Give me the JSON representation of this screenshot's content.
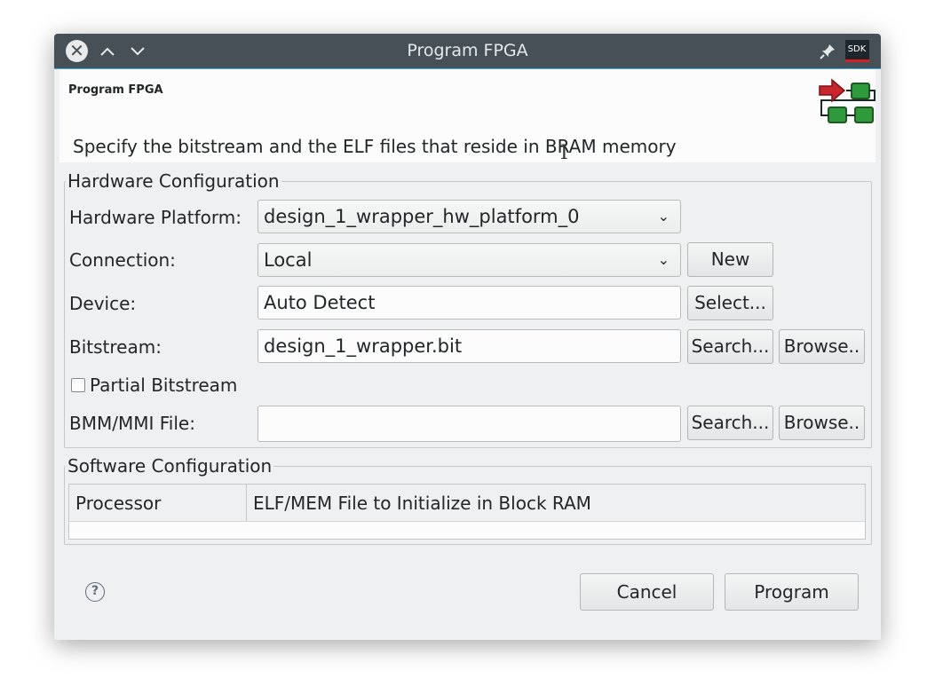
{
  "window": {
    "title": "Program FPGA",
    "sdk_badge": "SDK",
    "accent_color": "#3daee9",
    "titlebar_color": "#475057"
  },
  "header": {
    "title": "Program FPGA",
    "description": "Specify the bitstream and the ELF files that reside in BRAM memory"
  },
  "hardware": {
    "group_title": "Hardware Configuration",
    "platform_label": "Hardware Platform:",
    "platform_value": "design_1_wrapper_hw_platform_0",
    "connection_label": "Connection:",
    "connection_value": "Local",
    "new_button": "New",
    "device_label": "Device:",
    "device_value": "Auto Detect",
    "select_button": "Select...",
    "bitstream_label": "Bitstream:",
    "bitstream_value": "design_1_wrapper.bit",
    "search_button": "Search...",
    "browse_button": "Browse..",
    "partial_label": "Partial Bitstream",
    "partial_checked": false,
    "bmm_label": "BMM/MMI File:",
    "bmm_value": "",
    "search_button_2": "Search...",
    "browse_button_2": "Browse.."
  },
  "software": {
    "group_title": "Software Configuration",
    "columns": [
      "Processor",
      "ELF/MEM File to Initialize in Block RAM"
    ]
  },
  "footer": {
    "cancel_button": "Cancel",
    "program_button": "Program"
  }
}
